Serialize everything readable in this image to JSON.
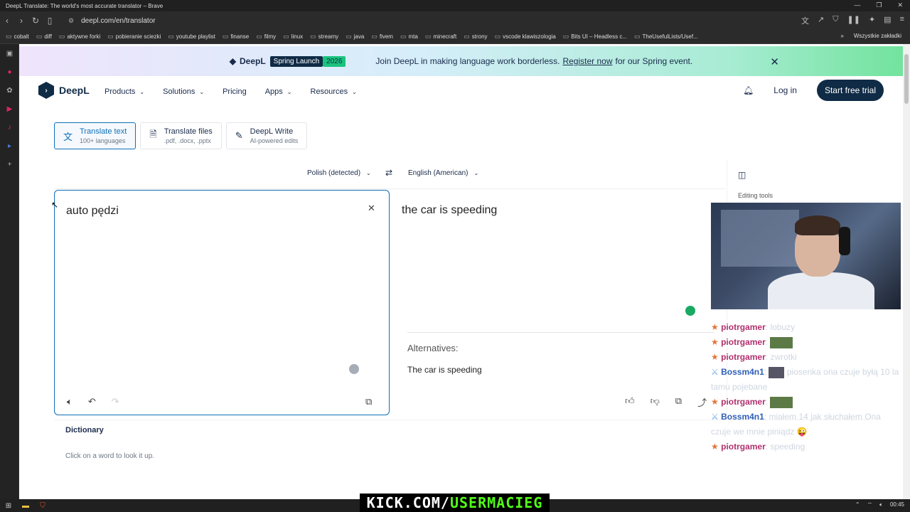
{
  "window": {
    "title": "DeepL Translate: The world's most accurate translator – Brave"
  },
  "browser": {
    "url": "deepl.com/en/translator"
  },
  "bookmarks": [
    "cobalt",
    "diff",
    "aktywne forki",
    "pobieranie sciezki",
    "youtube playlist",
    "finanse",
    "filmy",
    "linux",
    "streamy",
    "java",
    "fivem",
    "mta",
    "minecraft",
    "strony",
    "vscode klawiszologia",
    "Bits UI – Headless c...",
    "TheUsefulLists/Usef..."
  ],
  "bookmarks_more": "»",
  "bookmarks_all": "Wszystkie zakładki",
  "banner": {
    "brand": "DeepL",
    "badge": "Spring Launch",
    "year": "2026",
    "text_before": "Join DeepL in making language work borderless.",
    "link": "Register now",
    "text_after": "for our Spring event.",
    "close": "✕"
  },
  "header": {
    "logo": "DeepL",
    "menu": [
      "Products",
      "Solutions",
      "Pricing",
      "Apps",
      "Resources"
    ],
    "login": "Log in",
    "cta": "Start free trial"
  },
  "modes": [
    {
      "title": "Translate text",
      "sub": "100+ languages"
    },
    {
      "title": "Translate files",
      "sub": ".pdf, .docx, .pptx"
    },
    {
      "title": "DeepL Write",
      "sub": "AI-powered edits"
    }
  ],
  "translator": {
    "source_lang": "Polish (detected)",
    "target_lang": "English (American)",
    "source_text": "auto pędzi",
    "target_text": "the car is speeding",
    "alternatives_label": "Alternatives:",
    "alternative": "The car is speeding"
  },
  "side_panel": {
    "label": "Editing tools"
  },
  "dictionary": {
    "title": "Dictionary",
    "hint": "Click on a word to look it up."
  },
  "chat": [
    {
      "user": "piotrgamer",
      "msg": "lobuzy",
      "badge": "star"
    },
    {
      "user": "piotrgamer",
      "msg": "",
      "badge": "star",
      "emote": true
    },
    {
      "user": "piotrgamer",
      "msg": "zwrotki",
      "badge": "star"
    },
    {
      "user": "Bossm4n1",
      "msg": "piosenka ona czuje byłą 10 la tamu pojebane",
      "badge": "sword",
      "emote": true
    },
    {
      "user": "piotrgamer",
      "msg": "",
      "badge": "star",
      "emote": true
    },
    {
      "user": "Bossm4n1",
      "msg": "miałem 14 jak słuchałem Ona czuje we mnie piniądz 😜",
      "badge": "sword"
    },
    {
      "user": "piotrgamer",
      "msg": "speeding",
      "badge": "star"
    }
  ],
  "overlay": {
    "kick_a": "KICK.COM/",
    "kick_b": "USERMACIEG"
  },
  "taskbar": {
    "time": "00:45"
  }
}
